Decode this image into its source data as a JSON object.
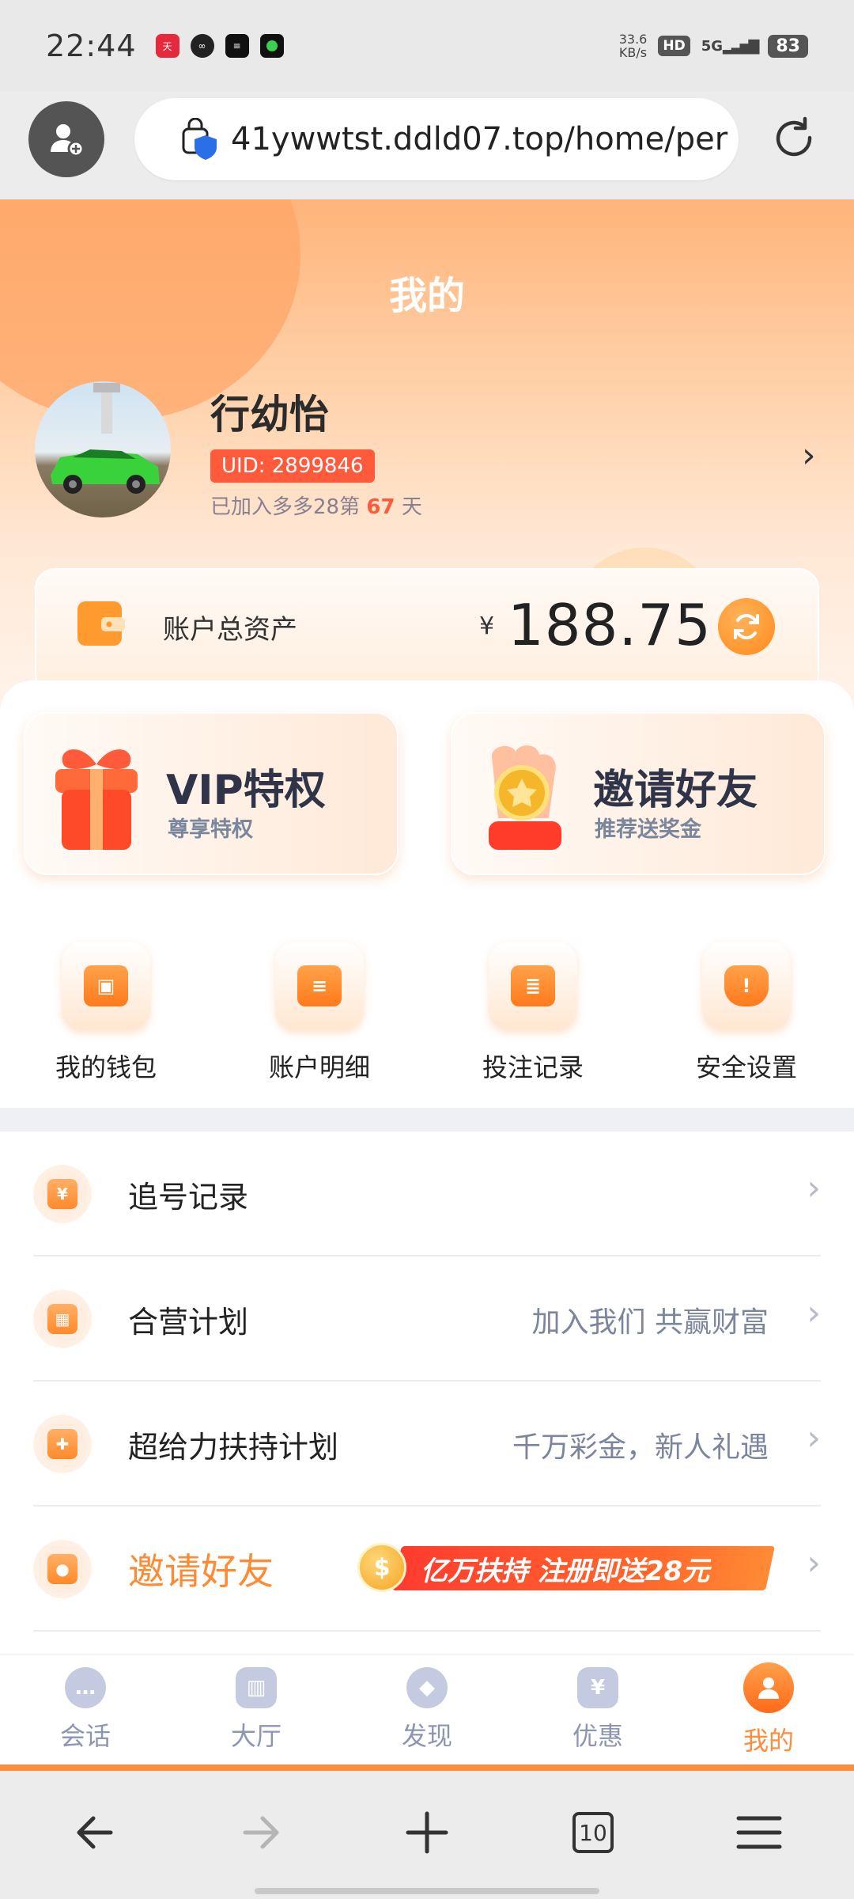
{
  "status_bar": {
    "time": "22:44",
    "net_speed_value": "33.6",
    "net_speed_unit": "KB/s",
    "hd": "HD",
    "signal": "5G",
    "battery": "83",
    "app_icons": [
      "tmall-icon",
      "link-icon",
      "news-icon",
      "game-icon"
    ]
  },
  "browser": {
    "url": "41ywwtst.ddld07.top/home/per"
  },
  "header": {
    "title": "我的"
  },
  "profile": {
    "name": "行幼怡",
    "uid": "UID: 2899846",
    "join_prefix": "已加入多多28第",
    "join_days": "67",
    "join_suffix": "天"
  },
  "assets": {
    "label": "账户总资产",
    "currency": "¥",
    "value": "188.75"
  },
  "promos": [
    {
      "title": "VIP特权",
      "subtitle": "尊享特权"
    },
    {
      "title": "邀请好友",
      "subtitle": "推荐送奖金"
    }
  ],
  "quick_actions": [
    {
      "label": "我的钱包"
    },
    {
      "label": "账户明细"
    },
    {
      "label": "投注记录"
    },
    {
      "label": "安全设置"
    }
  ],
  "menu": [
    {
      "label": "追号记录",
      "note": ""
    },
    {
      "label": "合营计划",
      "note": "加入我们 共赢财富"
    },
    {
      "label": "超给力扶持计划",
      "note": "千万彩金，新人礼遇"
    },
    {
      "label": "邀请好友",
      "banner": "亿万扶持 注册即送28元"
    }
  ],
  "tabbar": [
    {
      "label": "会话",
      "active": false
    },
    {
      "label": "大厅",
      "active": false
    },
    {
      "label": "发现",
      "active": false
    },
    {
      "label": "优惠",
      "active": false
    },
    {
      "label": "我的",
      "active": true
    }
  ],
  "browser_nav": {
    "tabs_count": "10"
  },
  "colors": {
    "accent": "#ff8c3a",
    "uid_badge": "#ff5a3c",
    "tab_inactive": "#8d96b0"
  }
}
